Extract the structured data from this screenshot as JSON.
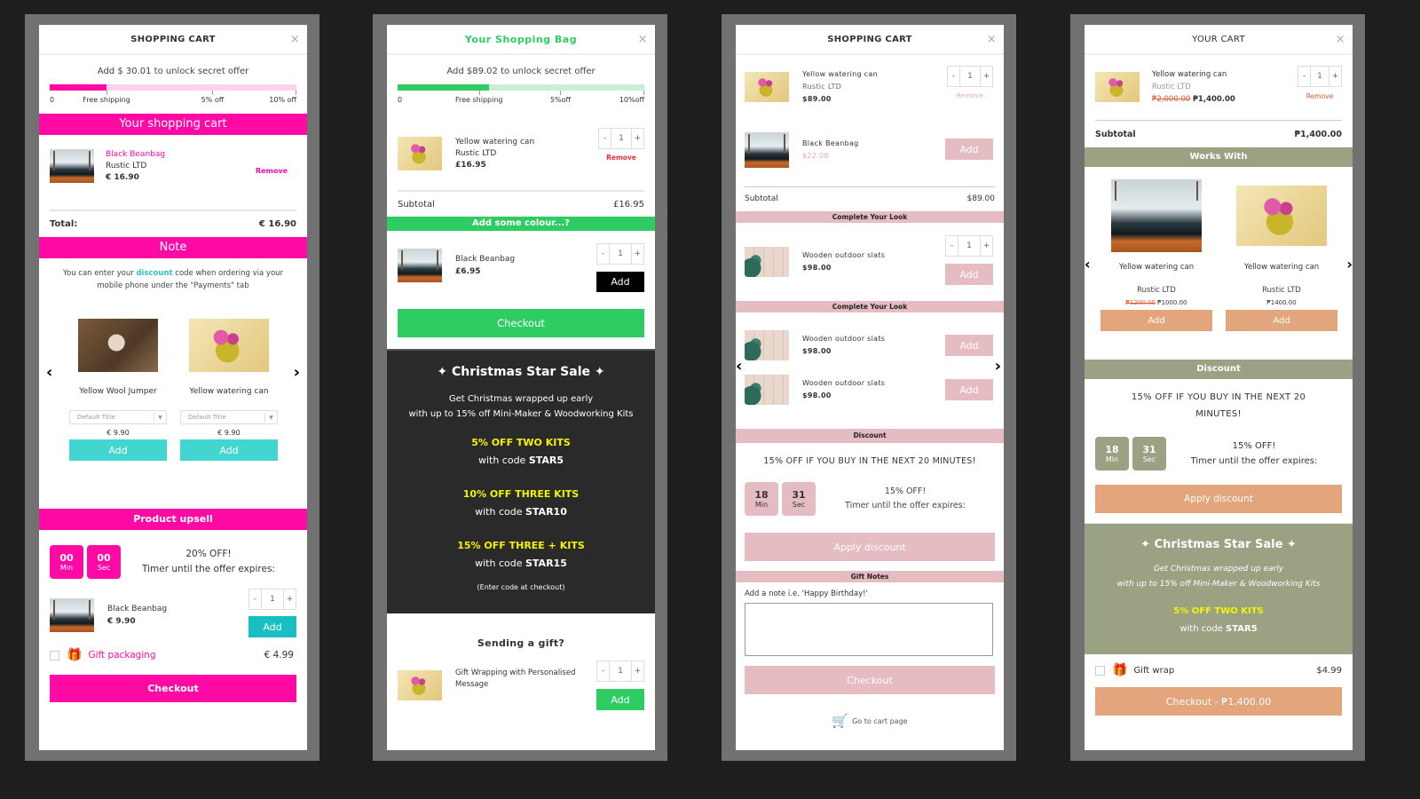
{
  "panel1": {
    "title": "SHOPPING CART",
    "close": "×",
    "progress_text": "Add $ 30.01 to unlock secret offer",
    "progress_fraction": 0.23,
    "milestones": [
      "0",
      "Free shipping",
      "5% off",
      "10% off"
    ],
    "colors": {
      "accent": "#ff0aa5",
      "accent_light": "#ffd3ee",
      "teal": "#43d6d0"
    },
    "cart_section": "Your shopping cart",
    "cart_item": {
      "name": "Black Beanbag",
      "vendor": "Rustic LTD",
      "price": "€ 16.90",
      "remove": "Remove"
    },
    "total_label": "Total:",
    "total_value": "€ 16.90",
    "note_section": "Note",
    "note_pre": "You can enter your ",
    "note_link": "discount",
    "note_post": " code when ordering via your mobile phone under the \"Payments\" tab",
    "carousel": [
      {
        "name": "Yellow Wool Jumper",
        "variant": "Default Title",
        "price": "€ 9.90",
        "add": "Add"
      },
      {
        "name": "Yellow watering can",
        "variant": "Default Title",
        "price": "€ 9.90",
        "add": "Add"
      }
    ],
    "prev": "‹",
    "next": "›",
    "upsell_section": "Product upsell",
    "timer": {
      "min": "00",
      "min_label": "Min",
      "sec": "00",
      "sec_label": "Sec",
      "headline": "20% OFF!",
      "subline": "Timer until the offer expires:"
    },
    "upsell_item": {
      "name": "Black Beanbag",
      "price": "€ 9.90",
      "qty": "1",
      "add": "Add"
    },
    "gift_label": "Gift packaging",
    "gift_price": "€ 4.99",
    "checkout": "Checkout"
  },
  "panel2": {
    "title": "Your Shopping Bag",
    "close": "×",
    "progress_text": "Add $89.02 to unlock secret offer",
    "progress_fraction": 0.37,
    "milestones": [
      "0",
      "Free shipping",
      "5%off",
      "10%off"
    ],
    "colors": {
      "accent": "#2ecc63",
      "accent_light": "#c9f0d6",
      "dark": "#2a2a2a",
      "yellow": "#f4f400"
    },
    "cart_item": {
      "name": "Yellow watering can",
      "vendor": "Rustic LTD",
      "price": "£16.95",
      "qty": "1",
      "remove": "Remove"
    },
    "subtotal_label": "Subtotal",
    "subtotal_value": "£16.95",
    "upsell_section": "Add some colour...?",
    "upsell_item": {
      "name": "Black Beanbag",
      "price": "£6.95",
      "qty": "1",
      "add": "Add"
    },
    "checkout": "Checkout",
    "promo": {
      "title": "Christmas Star Sale",
      "line1": "Get Christmas wrapped up early",
      "line2": "with up to 15% off Mini-Maker & Woodworking Kits",
      "offers": [
        {
          "headline": "5% OFF TWO KITS",
          "prefix": "with code ",
          "code": "STAR5"
        },
        {
          "headline": "10% OFF THREE KITS",
          "prefix": "with code ",
          "code": "STAR10"
        },
        {
          "headline": "15% OFF THREE + KITS",
          "prefix": "with code ",
          "code": "STAR15"
        }
      ],
      "footnote": "(Enter code at checkout)"
    },
    "gift_heading": "Sending a gift?",
    "gift_item": {
      "name": "Gift Wrapping with Personalised Message",
      "qty": "1",
      "add": "Add"
    }
  },
  "panel3": {
    "title": "SHOPPING CART",
    "close": "×",
    "colors": {
      "accent": "#e5bcc2",
      "accent_text": "#e8a5ae"
    },
    "cart_item": {
      "name": "Yellow watering can",
      "vendor": "Rustic LTD",
      "price": "$89.00",
      "qty": "1",
      "remove": "Remove"
    },
    "suggest_item": {
      "name": "Black Beanbag",
      "price": "$22.00",
      "add": "Add"
    },
    "subtotal_label": "Subtotal",
    "subtotal_value": "$89.00",
    "look1_section": "Complete Your Look",
    "look1_item": {
      "name": "Wooden outdoor slats",
      "price": "$98.00",
      "qty": "1",
      "add": "Add"
    },
    "look2_section": "Complete Your Look",
    "look2_items": [
      {
        "name": "Wooden outdoor slats",
        "price": "$98.00",
        "add": "Add"
      },
      {
        "name": "Wooden outdoor slats",
        "price": "$98.00",
        "add": "Add"
      }
    ],
    "prev": "‹",
    "next": "›",
    "discount_section": "Discount",
    "discount_headline": "15% OFF IF YOU BUY IN THE NEXT 20 MINUTES!",
    "timer": {
      "min": "18",
      "min_label": "Min",
      "sec": "31",
      "sec_label": "Sec",
      "headline": "15% OFF!",
      "subline": "Timer until the offer expires:"
    },
    "apply": "Apply discount",
    "notes_section": "Gift Notes",
    "notes_label": "Add a note i.e. 'Happy Birthday!'",
    "notes_value": "",
    "checkout": "Checkout",
    "cart_link": "Go to cart page"
  },
  "panel4": {
    "title": "YOUR CART",
    "close": "×",
    "colors": {
      "olive": "#9aa283",
      "orange": "#e2a57c",
      "yellow": "#f4f400"
    },
    "cart_item": {
      "name": "Yellow watering can",
      "vendor": "Rustic LTD",
      "old_price": "₱2,000.00",
      "price": "₱1,400.00",
      "qty": "1",
      "remove": "Remove"
    },
    "subtotal_label": "Subtotal",
    "subtotal_value": "₱1,400.00",
    "works_section": "Works With",
    "carousel": [
      {
        "name": "Yellow watering can",
        "vendor": "Rustic LTD",
        "old_price": "₱1200.00",
        "price": "₱1000.00",
        "add": "Add"
      },
      {
        "name": "Yellow watering can",
        "vendor": "Rustic LTD",
        "old_price": "",
        "price": "₱1400.00",
        "add": "Add"
      }
    ],
    "prev": "‹",
    "next": "›",
    "discount_section": "Discount",
    "discount_headline": "15% OFF IF YOU BUY IN THE NEXT 20 MINUTES!",
    "timer": {
      "min": "18",
      "min_label": "Min",
      "sec": "31",
      "sec_label": "Sec",
      "headline": "15% OFF!",
      "subline": "Timer until the offer expires:"
    },
    "apply": "Apply discount",
    "promo": {
      "title": "Christmas Star Sale",
      "line1": "Get Christmas wrapped up early",
      "line2": "with up to 15% off Mini-Maker & Woodworking Kits",
      "offer_headline": "5% OFF TWO KITS",
      "offer_prefix": "with code ",
      "offer_code": "STAR5"
    },
    "gift_label": "Gift wrap",
    "gift_price": "$4.99",
    "checkout": "Checkout - ₱1,400.00"
  },
  "icons": {
    "sparkle": "✦",
    "gift": "🎁",
    "cart": "🛒"
  }
}
